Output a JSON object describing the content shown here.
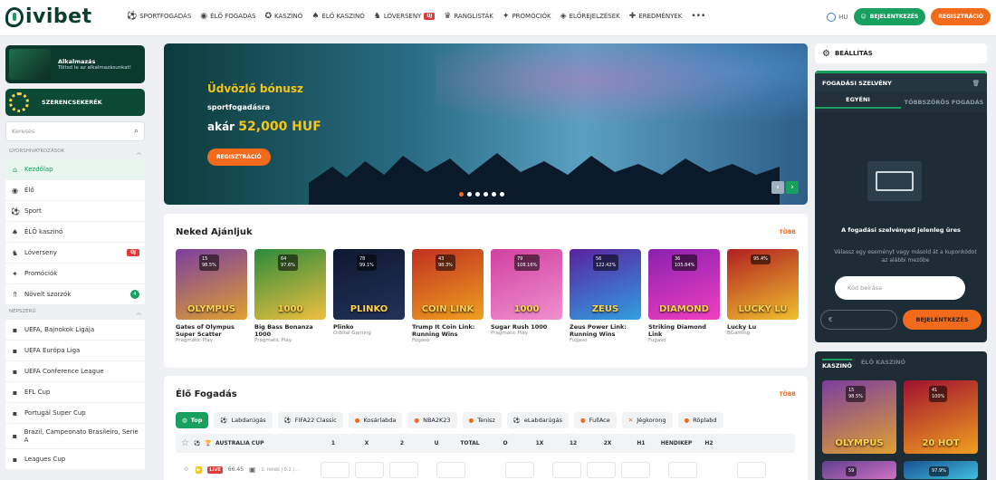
{
  "header": {
    "logo": "ivibet",
    "nav": [
      {
        "label": "SPORTFOGADÁS",
        "icon": "soccer-icon"
      },
      {
        "label": "ÉLŐ FOGADÁS",
        "icon": "live-icon"
      },
      {
        "label": "KASZINÓ",
        "icon": "casino-chip-icon"
      },
      {
        "label": "ÉLŐ KASZINÓ",
        "icon": "live-casino-icon"
      },
      {
        "label": "LÓVERSENY",
        "icon": "horse-icon",
        "badge": "ÚJ"
      },
      {
        "label": "RANGLISTÁK",
        "icon": "trophy-icon"
      },
      {
        "label": "PROMÓCIÓK",
        "icon": "gift-icon"
      },
      {
        "label": "ELŐREJELZÉSEK",
        "icon": "prediction-icon"
      },
      {
        "label": "EREDMÉNYEK",
        "icon": "results-icon"
      }
    ],
    "more": "•••",
    "lang": "HU",
    "login": "BEJELENTKEZÉS",
    "register": "REGISZTRÁCIÓ"
  },
  "sidebar": {
    "app_title": "Alkalmazás",
    "app_sub": "Töltsd le az alkalmazásunkat!",
    "wheel": "SZERENCSEKERÉK",
    "search_placeholder": "Keresés",
    "quick_header": "GYORSHIVATKOZÁSOK",
    "quick": [
      {
        "label": "Kezdőlap",
        "icon": "home-icon",
        "active": true
      },
      {
        "label": "Élő",
        "icon": "live-icon"
      },
      {
        "label": "Sport",
        "icon": "soccer-icon"
      },
      {
        "label": "ÉLŐ kaszinó",
        "icon": "live-casino-icon"
      },
      {
        "label": "Lóverseny",
        "icon": "horse-icon",
        "badge": "ÚJ"
      },
      {
        "label": "Promóciók",
        "icon": "gift-icon"
      },
      {
        "label": "Növelt szorzók",
        "icon": "boost-icon",
        "badge": "4"
      }
    ],
    "popular_header": "NÉPSZERŰ",
    "popular": [
      {
        "label": "UEFA, Bajnokok Ligája"
      },
      {
        "label": "UEFA Európa Liga"
      },
      {
        "label": "UEFA Conference League"
      },
      {
        "label": "EFL Cup"
      },
      {
        "label": "Portugál Super Cup"
      },
      {
        "label": "Brazil, Campeonato Brasileiro, Serie A"
      },
      {
        "label": "Leagues Cup"
      }
    ]
  },
  "banner": {
    "title": "Üdvözlő bónusz",
    "line2": "sportfogadásra",
    "prefix": "akár",
    "amount": "52,000 HUF",
    "button": "REGISZTRÁCIÓ"
  },
  "recommended": {
    "title": "Neked Ajánljuk",
    "more": "TÖBB",
    "games": [
      {
        "name": "Gates of Olympus Super Scatter",
        "provider": "Pragmatic Play",
        "players": "15",
        "rtp": "98.5%",
        "colors": [
          "#7a3ea0",
          "#e0a030"
        ],
        "art": "OLYMPUS"
      },
      {
        "name": "Big Bass Bonanza 1000",
        "provider": "Pragmatic Play",
        "players": "64",
        "rtp": "97.6%",
        "colors": [
          "#2a8a3a",
          "#f0c040"
        ],
        "art": "1000"
      },
      {
        "name": "Plinko",
        "provider": "Orbital Gaming",
        "players": "78",
        "rtp": "99.1%",
        "colors": [
          "#0e1830",
          "#22325a"
        ],
        "art": "PLINKO"
      },
      {
        "name": "Trump It Coin Link: Running Wins",
        "provider": "Fugaso",
        "players": "43",
        "rtp": "98.3%",
        "colors": [
          "#c03020",
          "#f0a020"
        ],
        "art": "COIN LINK"
      },
      {
        "name": "Sugar Rush 1000",
        "provider": "Pragmatic Play",
        "players": "79",
        "rtp": "108.16%",
        "colors": [
          "#d040a0",
          "#f090d0"
        ],
        "art": "1000"
      },
      {
        "name": "Zeus Power Link: Running Wins",
        "provider": "Fugaso",
        "players": "56",
        "rtp": "122.42%",
        "colors": [
          "#5a20a0",
          "#30a0e0"
        ],
        "art": "ZEUS"
      },
      {
        "name": "Striking Diamond Link",
        "provider": "Fugaso",
        "players": "36",
        "rtp": "105.84%",
        "colors": [
          "#8a20b0",
          "#f040c0"
        ],
        "art": "DIAMOND"
      },
      {
        "name": "Lucky Lu",
        "provider": "BGaming",
        "players": "",
        "rtp": "95.4%",
        "colors": [
          "#b02020",
          "#f0c030"
        ],
        "art": "LUCKY LU"
      }
    ]
  },
  "live": {
    "title": "Élő Fogadás",
    "more": "TÖBB",
    "pills": [
      {
        "label": "Top",
        "active": true
      },
      {
        "label": "Labdarúgás"
      },
      {
        "label": "FIFA22 Classic"
      },
      {
        "label": "Kosárlabda"
      },
      {
        "label": "NBA2K23"
      },
      {
        "label": "Tenisz"
      },
      {
        "label": "eLabdarúgás"
      },
      {
        "label": "FullAce"
      },
      {
        "label": "Jégkorong"
      },
      {
        "label": "Röplabd"
      }
    ],
    "league": "AUSTRALIA CUP",
    "cols": [
      "1",
      "X",
      "2",
      "U",
      "TOTAL",
      "O",
      "1X",
      "12",
      "2X",
      "H1",
      "HENDIKEP",
      "H2"
    ],
    "row_time": "66:45",
    "row_half": "2. félidő | 0:2 (..."
  },
  "betslip": {
    "settings": "BEÁLLÍTÁS",
    "title": "FOGADÁSI SZELVÉNY",
    "tab_single": "EGYÉNI",
    "tab_multi": "TÖBBSZÖRÖS FOGADÁS",
    "empty": "A fogadási szelvényed jelenleg üres",
    "hint": "Válassz egy eseményt vagy másold át a kuponkódot az alábbi mezőbe",
    "code_placeholder": "Kód beírása",
    "currency": "€",
    "login": "BEJELENTKEZÉS"
  },
  "casino": {
    "tab1": "KASZINÓ",
    "tab2": "ÉLŐ KASZINÓ",
    "games": [
      {
        "players": "15",
        "rtp": "98.5%",
        "colors": [
          "#7a3ea0",
          "#e0a030"
        ],
        "art": "OLYMPUS"
      },
      {
        "players": "41",
        "rtp": "100%",
        "colors": [
          "#a01030",
          "#f0a020"
        ],
        "art": "20 HOT"
      },
      {
        "players": "59",
        "rtp": "",
        "colors": [
          "#604090",
          "#d070c0"
        ],
        "art": ""
      },
      {
        "players": "",
        "rtp": "97.9%",
        "colors": [
          "#1a5090",
          "#40c0e0"
        ],
        "art": ""
      }
    ]
  }
}
